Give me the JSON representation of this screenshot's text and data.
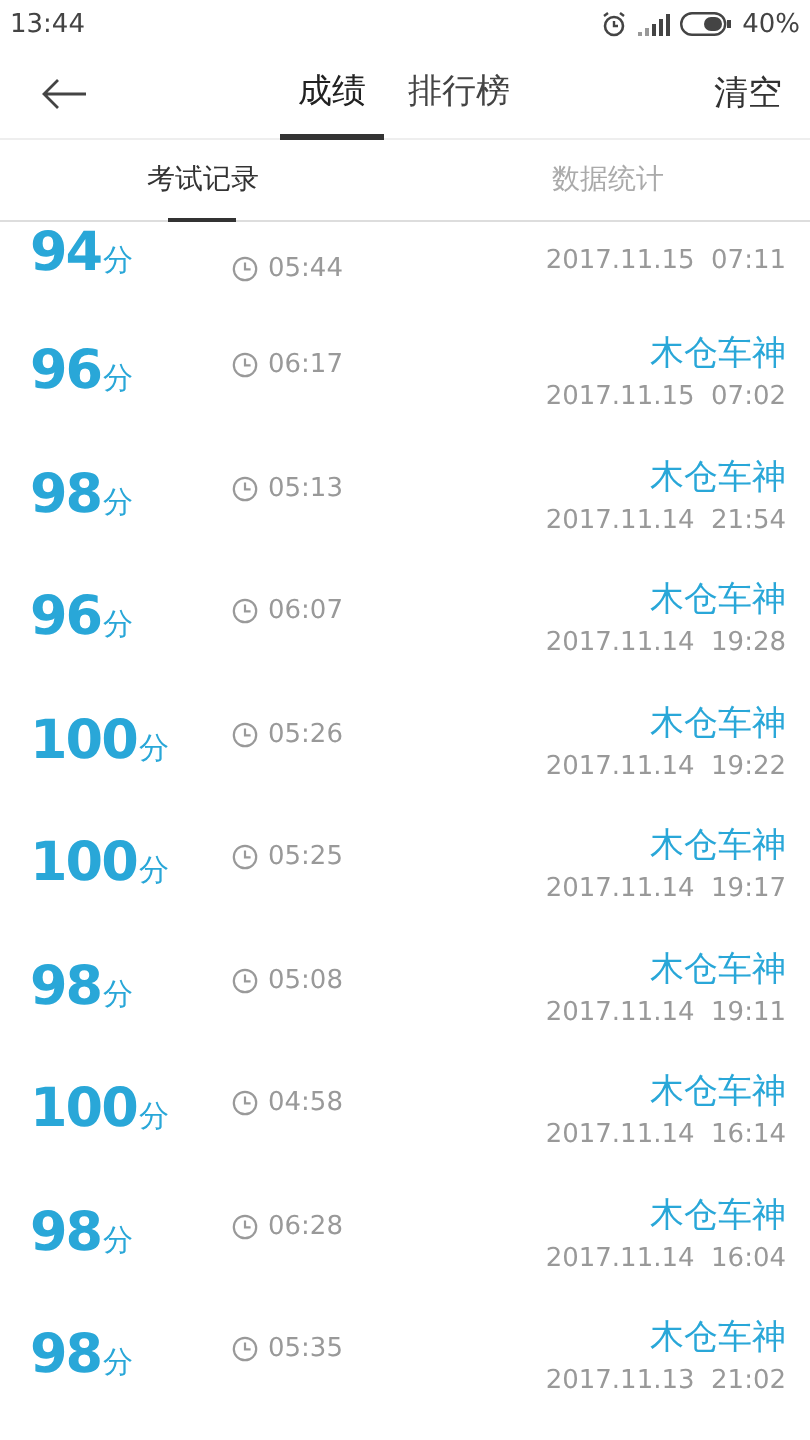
{
  "status_bar": {
    "time": "13:44",
    "battery": "40%"
  },
  "header": {
    "tabs": [
      {
        "label": "成绩",
        "selected": true
      },
      {
        "label": "排行榜",
        "selected": false
      }
    ],
    "action": "清空"
  },
  "subtabs": [
    {
      "label": "考试记录",
      "selected": true
    },
    {
      "label": "数据统计",
      "selected": false
    }
  ],
  "records": [
    {
      "score": "94",
      "unit": "分",
      "duration": "05:44",
      "date": "2017.11.15  07:11"
    },
    {
      "score": "96",
      "unit": "分",
      "duration": "06:17",
      "name": "木仓车神",
      "date": "2017.11.15  07:02"
    },
    {
      "score": "98",
      "unit": "分",
      "duration": "05:13",
      "name": "木仓车神",
      "date": "2017.11.14  21:54"
    },
    {
      "score": "96",
      "unit": "分",
      "duration": "06:07",
      "name": "木仓车神",
      "date": "2017.11.14  19:28"
    },
    {
      "score": "100",
      "unit": "分",
      "duration": "05:26",
      "name": "木仓车神",
      "date": "2017.11.14  19:22"
    },
    {
      "score": "100",
      "unit": "分",
      "duration": "05:25",
      "name": "木仓车神",
      "date": "2017.11.14  19:17"
    },
    {
      "score": "98",
      "unit": "分",
      "duration": "05:08",
      "name": "木仓车神",
      "date": "2017.11.14  19:11"
    },
    {
      "score": "100",
      "unit": "分",
      "duration": "04:58",
      "name": "木仓车神",
      "date": "2017.11.14  16:14"
    },
    {
      "score": "98",
      "unit": "分",
      "duration": "06:28",
      "name": "木仓车神",
      "date": "2017.11.14  16:04"
    },
    {
      "score": "98",
      "unit": "分",
      "duration": "05:35",
      "name": "木仓车神",
      "date": "2017.11.13  21:02"
    }
  ]
}
